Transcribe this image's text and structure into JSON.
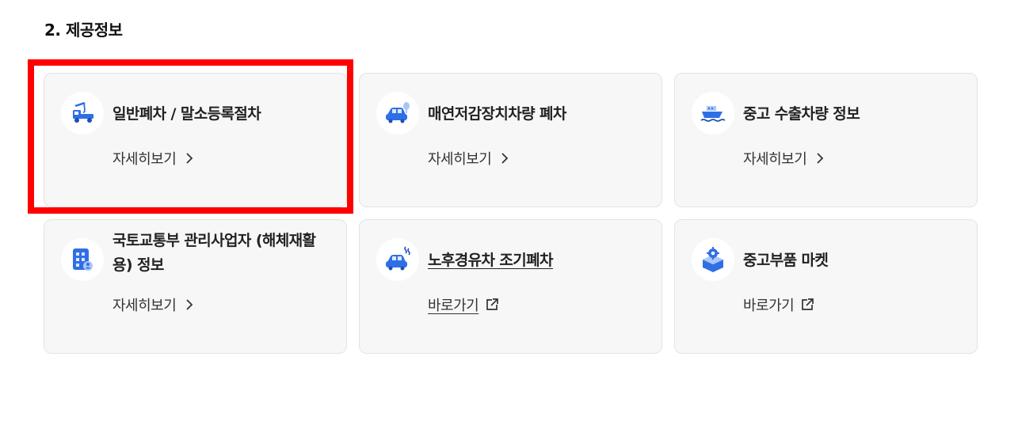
{
  "section": {
    "title": "2. 제공정보"
  },
  "cards": [
    {
      "title": "일반폐차 / 말소등록절차",
      "link": "자세히보기",
      "icon": "tow-truck-icon",
      "link_icon": "chevron-right-icon"
    },
    {
      "title": "매연저감장치차량 폐차",
      "link": "자세히보기",
      "icon": "car-with-filter-icon",
      "link_icon": "chevron-right-icon"
    },
    {
      "title": "중고 수출차량 정보",
      "link": "자세히보기",
      "icon": "cargo-ship-icon",
      "link_icon": "chevron-right-icon"
    },
    {
      "title": "국토교통부 관리사업자 (해체재활용) 정보",
      "link": "자세히보기",
      "icon": "building-person-icon",
      "link_icon": "chevron-right-icon"
    },
    {
      "title": "노후경유차 조기폐차",
      "link": "바로가기",
      "icon": "car-exhaust-icon",
      "link_icon": "external-link-icon"
    },
    {
      "title": "중고부품 마켓",
      "link": "바로가기",
      "icon": "parts-box-icon",
      "link_icon": "external-link-icon"
    }
  ],
  "colors": {
    "accent": "#2f6fe6",
    "highlight": "#ff0000",
    "card_bg": "#f7f7f7"
  }
}
